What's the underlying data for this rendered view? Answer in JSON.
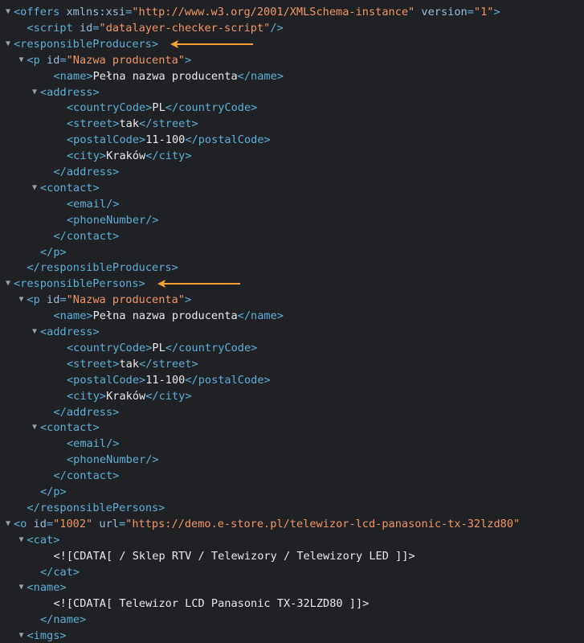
{
  "arrow_color": "#f6a02f",
  "colors": {
    "tag": "#5db0d7",
    "attr_name": "#9bbbdc",
    "attr_value": "#f29766",
    "text": "#e8eaed",
    "background": "#202124"
  },
  "lines": [
    {
      "indent": 0,
      "toggle": "expanded",
      "parts": [
        [
          "t",
          "<offers"
        ],
        [
          "an",
          " xmlns:xsi"
        ],
        [
          "t",
          "="
        ],
        [
          "av",
          "\"http://www.w3.org/2001/XMLSchema-instance\""
        ],
        [
          "an",
          " version"
        ],
        [
          "t",
          "="
        ],
        [
          "av",
          "\"1\""
        ],
        [
          "t",
          ">"
        ]
      ]
    },
    {
      "indent": 1,
      "toggle": "none",
      "parts": [
        [
          "t",
          "<script"
        ],
        [
          "an",
          " id"
        ],
        [
          "t",
          "="
        ],
        [
          "av",
          "\"datalayer-checker-script\""
        ],
        [
          "t",
          "/>"
        ]
      ]
    },
    {
      "indent": 0,
      "toggle": "expanded",
      "arrow": true,
      "parts": [
        [
          "t",
          "<responsibleProducers>"
        ]
      ]
    },
    {
      "indent": 1,
      "toggle": "expanded",
      "parts": [
        [
          "t",
          "<p"
        ],
        [
          "an",
          " id"
        ],
        [
          "t",
          "="
        ],
        [
          "av",
          "\"Nazwa producenta\""
        ],
        [
          "t",
          ">"
        ]
      ]
    },
    {
      "indent": 3,
      "toggle": "none",
      "parts": [
        [
          "t",
          "<name>"
        ],
        [
          "tx",
          "Pełna nazwa producenta"
        ],
        [
          "t",
          "</name>"
        ]
      ]
    },
    {
      "indent": 2,
      "toggle": "expanded",
      "parts": [
        [
          "t",
          "<address>"
        ]
      ]
    },
    {
      "indent": 4,
      "toggle": "none",
      "parts": [
        [
          "t",
          "<countryCode>"
        ],
        [
          "tx",
          "PL"
        ],
        [
          "t",
          "</countryCode>"
        ]
      ]
    },
    {
      "indent": 4,
      "toggle": "none",
      "parts": [
        [
          "t",
          "<street>"
        ],
        [
          "tx",
          "tak"
        ],
        [
          "t",
          "</street>"
        ]
      ]
    },
    {
      "indent": 4,
      "toggle": "none",
      "parts": [
        [
          "t",
          "<postalCode>"
        ],
        [
          "tx",
          "11-100"
        ],
        [
          "t",
          "</postalCode>"
        ]
      ]
    },
    {
      "indent": 4,
      "toggle": "none",
      "parts": [
        [
          "t",
          "<city>"
        ],
        [
          "tx",
          "Kraków"
        ],
        [
          "t",
          "</city>"
        ]
      ]
    },
    {
      "indent": 3,
      "toggle": "none",
      "parts": [
        [
          "t",
          "</address>"
        ]
      ]
    },
    {
      "indent": 2,
      "toggle": "expanded",
      "parts": [
        [
          "t",
          "<contact>"
        ]
      ]
    },
    {
      "indent": 4,
      "toggle": "none",
      "parts": [
        [
          "t",
          "<email/>"
        ]
      ]
    },
    {
      "indent": 4,
      "toggle": "none",
      "parts": [
        [
          "t",
          "<phoneNumber/>"
        ]
      ]
    },
    {
      "indent": 3,
      "toggle": "none",
      "parts": [
        [
          "t",
          "</contact>"
        ]
      ]
    },
    {
      "indent": 2,
      "toggle": "none",
      "parts": [
        [
          "t",
          "</p>"
        ]
      ]
    },
    {
      "indent": 1,
      "toggle": "none",
      "parts": [
        [
          "t",
          "</responsibleProducers>"
        ]
      ]
    },
    {
      "indent": 0,
      "toggle": "expanded",
      "arrow": true,
      "parts": [
        [
          "t",
          "<responsiblePersons>"
        ]
      ]
    },
    {
      "indent": 1,
      "toggle": "expanded",
      "parts": [
        [
          "t",
          "<p"
        ],
        [
          "an",
          " id"
        ],
        [
          "t",
          "="
        ],
        [
          "av",
          "\"Nazwa producenta\""
        ],
        [
          "t",
          ">"
        ]
      ]
    },
    {
      "indent": 3,
      "toggle": "none",
      "parts": [
        [
          "t",
          "<name>"
        ],
        [
          "tx",
          "Pełna nazwa producenta"
        ],
        [
          "t",
          "</name>"
        ]
      ]
    },
    {
      "indent": 2,
      "toggle": "expanded",
      "parts": [
        [
          "t",
          "<address>"
        ]
      ]
    },
    {
      "indent": 4,
      "toggle": "none",
      "parts": [
        [
          "t",
          "<countryCode>"
        ],
        [
          "tx",
          "PL"
        ],
        [
          "t",
          "</countryCode>"
        ]
      ]
    },
    {
      "indent": 4,
      "toggle": "none",
      "parts": [
        [
          "t",
          "<street>"
        ],
        [
          "tx",
          "tak"
        ],
        [
          "t",
          "</street>"
        ]
      ]
    },
    {
      "indent": 4,
      "toggle": "none",
      "parts": [
        [
          "t",
          "<postalCode>"
        ],
        [
          "tx",
          "11-100"
        ],
        [
          "t",
          "</postalCode>"
        ]
      ]
    },
    {
      "indent": 4,
      "toggle": "none",
      "parts": [
        [
          "t",
          "<city>"
        ],
        [
          "tx",
          "Kraków"
        ],
        [
          "t",
          "</city>"
        ]
      ]
    },
    {
      "indent": 3,
      "toggle": "none",
      "parts": [
        [
          "t",
          "</address>"
        ]
      ]
    },
    {
      "indent": 2,
      "toggle": "expanded",
      "parts": [
        [
          "t",
          "<contact>"
        ]
      ]
    },
    {
      "indent": 4,
      "toggle": "none",
      "parts": [
        [
          "t",
          "<email/>"
        ]
      ]
    },
    {
      "indent": 4,
      "toggle": "none",
      "parts": [
        [
          "t",
          "<phoneNumber/>"
        ]
      ]
    },
    {
      "indent": 3,
      "toggle": "none",
      "parts": [
        [
          "t",
          "</contact>"
        ]
      ]
    },
    {
      "indent": 2,
      "toggle": "none",
      "parts": [
        [
          "t",
          "</p>"
        ]
      ]
    },
    {
      "indent": 1,
      "toggle": "none",
      "parts": [
        [
          "t",
          "</responsiblePersons>"
        ]
      ]
    },
    {
      "indent": 0,
      "toggle": "expanded",
      "parts": [
        [
          "t",
          "<o"
        ],
        [
          "an",
          " id"
        ],
        [
          "t",
          "="
        ],
        [
          "av",
          "\"1002\""
        ],
        [
          "an",
          " url"
        ],
        [
          "t",
          "="
        ],
        [
          "av",
          "\"https://demo.e-store.pl/telewizor-lcd-panasonic-tx-32lzd80\""
        ]
      ]
    },
    {
      "indent": 1,
      "toggle": "expanded",
      "parts": [
        [
          "t",
          "<cat>"
        ]
      ]
    },
    {
      "indent": 3,
      "toggle": "none",
      "parts": [
        [
          "tx",
          "<![CDATA[ / Sklep RTV / Telewizory / Telewizory LED ]]>"
        ]
      ]
    },
    {
      "indent": 2,
      "toggle": "none",
      "parts": [
        [
          "t",
          "</cat>"
        ]
      ]
    },
    {
      "indent": 1,
      "toggle": "expanded",
      "parts": [
        [
          "t",
          "<name>"
        ]
      ]
    },
    {
      "indent": 3,
      "toggle": "none",
      "parts": [
        [
          "tx",
          "<![CDATA[ Telewizor LCD Panasonic TX-32LZD80 ]]>"
        ]
      ]
    },
    {
      "indent": 2,
      "toggle": "none",
      "parts": [
        [
          "t",
          "</name>"
        ]
      ]
    },
    {
      "indent": 1,
      "toggle": "expanded",
      "parts": [
        [
          "t",
          "<imgs>"
        ]
      ]
    }
  ]
}
